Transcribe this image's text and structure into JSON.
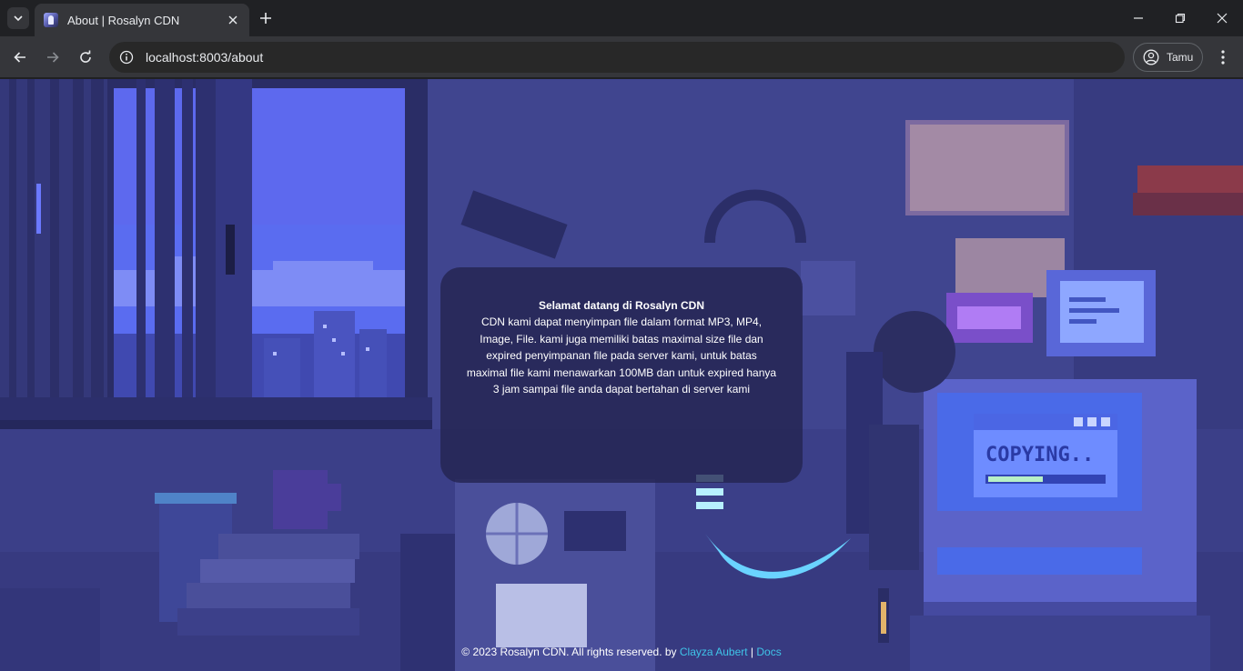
{
  "browser": {
    "tab_title": "About | Rosalyn CDN",
    "url_host": "localhost",
    "url_port_path": ":8003/about",
    "profile_label": "Tamu"
  },
  "icons": {
    "tab_search": "chevron-down-icon",
    "tab_close": "close-icon",
    "new_tab": "plus-icon",
    "minimize": "minimize-icon",
    "restore": "restore-icon",
    "close_window": "close-icon",
    "back": "arrow-left-icon",
    "forward": "arrow-right-icon",
    "reload": "reload-icon",
    "site_info": "info-icon",
    "profile": "person-icon",
    "menu": "more-vertical-icon"
  },
  "card": {
    "title": "Selamat datang di Rosalyn CDN",
    "body": "CDN kami dapat menyimpan file dalam format MP3, MP4, Image, File. kami juga memiliki batas maximal size file dan expired penyimpanan file pada server kami, untuk batas maximal file kami menawarkan 100MB dan untuk expired hanya 3 jam sampai file anda dapat bertahan di server kami"
  },
  "scene": {
    "monitor_text": "COPYING.."
  },
  "footer": {
    "copyright": "© 2023 Rosalyn CDN. All rights reserved. by ",
    "author_link": "Clayza Aubert",
    "separator": " | ",
    "docs_link": "Docs"
  },
  "colors": {
    "accent_link": "#3fc4e8",
    "scene_base": "#3b3f8c",
    "card_bg": "#23224e"
  }
}
